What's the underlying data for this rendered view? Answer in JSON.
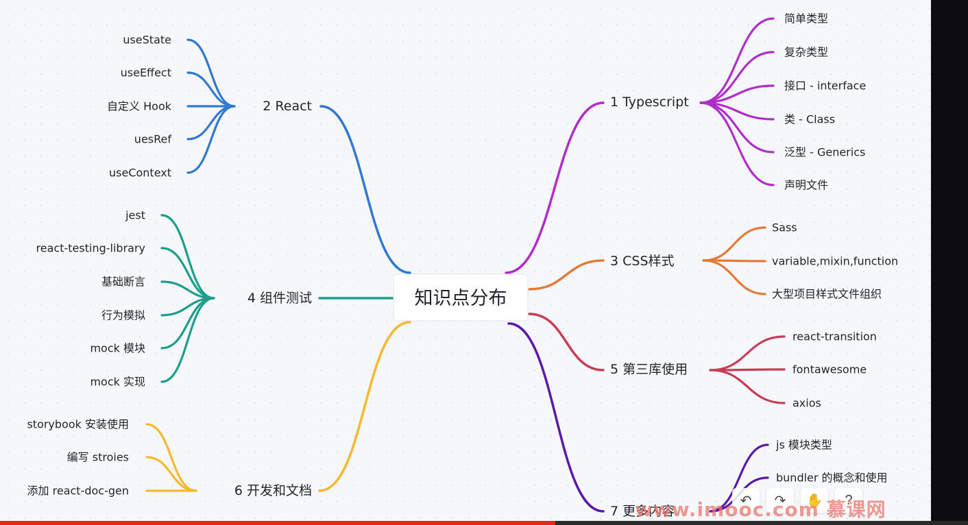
{
  "root": {
    "label": "知识点分布"
  },
  "branches": [
    {
      "label": "1 Typescript",
      "color": "#b02dc9",
      "children": [
        "简单类型",
        "复杂类型",
        "接口 - interface",
        "类 - Class",
        "泛型 - Generics",
        "声明文件"
      ]
    },
    {
      "label": "2 React",
      "color": "#3179d0",
      "children": [
        "useState",
        "useEffect",
        "自定义 Hook",
        "uesRef",
        "useContext"
      ]
    },
    {
      "label": "3 CSS样式",
      "color": "#e47a3a",
      "children": [
        "Sass",
        "variable,mixin,function",
        "大型项目样式文件组织"
      ]
    },
    {
      "label": "4 组件测试",
      "color": "#1d9e8a",
      "children": [
        "jest",
        "react-testing-library",
        "基础断言",
        "行为模拟",
        "mock 模块",
        "mock 实现"
      ]
    },
    {
      "label": "5 第三库使用",
      "color": "#c83c55",
      "children": [
        "react-transition",
        "fontawesome",
        "axios"
      ]
    },
    {
      "label": "6 开发和文档",
      "color": "#f5b82e",
      "children": [
        "storybook 安装使用",
        "编写 stroies",
        "添加 react-doc-gen"
      ]
    },
    {
      "label": "7 更多内容",
      "color": "#5a18a8",
      "children": [
        "js 模块类型",
        "bundler 的概念和使用"
      ]
    }
  ],
  "watermark": "www.imooc.com 慕课网",
  "toolbar": {
    "undo_icon": "undo-icon",
    "redo_icon": "redo-icon",
    "hand_icon": "hand-icon",
    "help_icon": "help-icon"
  }
}
